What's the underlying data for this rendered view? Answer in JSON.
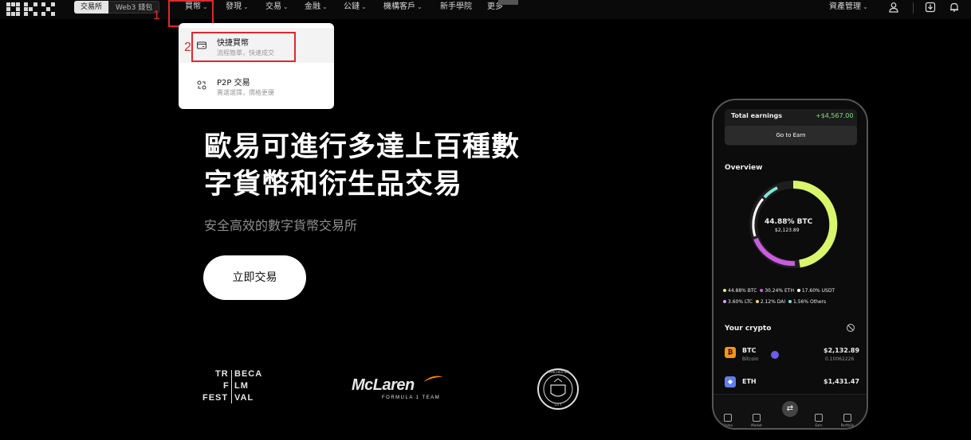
{
  "nav": {
    "segments": [
      "交易所",
      "Web3 錢包"
    ],
    "items": [
      {
        "label": "買幣",
        "chevron": true
      },
      {
        "label": "發現",
        "chevron": true
      },
      {
        "label": "交易",
        "chevron": true
      },
      {
        "label": "金融",
        "chevron": true
      },
      {
        "label": "公鏈",
        "chevron": true
      },
      {
        "label": "機構客戶",
        "chevron": true
      },
      {
        "label": "新手學院",
        "chevron": false
      },
      {
        "label": "更多",
        "chevron": false
      }
    ],
    "asset_management": "資產管理"
  },
  "annotations": {
    "step1": "1",
    "step2": "2"
  },
  "dropdown": {
    "items": [
      {
        "title": "快捷買幣",
        "subtitle": "流程簡單，快速成交",
        "icon": "card-icon"
      },
      {
        "title": "P2P 交易",
        "subtitle": "賣選選擇，價格更優",
        "icon": "p2p-users-icon"
      }
    ]
  },
  "hero": {
    "title_line1": "歐易可進行多達上百種數",
    "title_line2": "字貨幣和衍生品交易",
    "subtitle": "安全高效的數字貨幣交易所",
    "cta": "立即交易"
  },
  "partners": {
    "tribeca": [
      "TR",
      "BECA",
      "F",
      "LM",
      "FEST",
      "VAL"
    ],
    "mclaren_name": "McLaren",
    "mclaren_sub": "FORMULA 1 TEAM",
    "city_top": "MANCHESTER",
    "city_bottom": "CITY"
  },
  "phone": {
    "earnings_label": "Total earnings",
    "earnings_value": "+$4,567.00",
    "earn_button": "Go to Earn",
    "overview_label": "Overview",
    "donut_center_pct": "44.88% BTC",
    "donut_center_val": "$2,123.89",
    "legend": [
      {
        "label": "44.88% BTC",
        "color": "#d9f56b"
      },
      {
        "label": "30.24% ETH",
        "color": "#c95ce0"
      },
      {
        "label": "17.60% USDT",
        "color": "#ffffff"
      },
      {
        "label": "3.60% LTC",
        "color": "#e0a0ff"
      },
      {
        "label": "2.12% DAI",
        "color": "#f5d36b"
      },
      {
        "label": "1.56% Others",
        "color": "#7fe6d9"
      }
    ],
    "your_crypto_label": "Your crypto",
    "coins": [
      {
        "symbol": "BTC",
        "name": "Bitcoin",
        "price": "$2,132.89",
        "amount": "0.10062226",
        "color": "#f7931a"
      },
      {
        "symbol": "ETH",
        "name": "",
        "price": "$1,431.47",
        "amount": "",
        "color": "#627eea"
      }
    ],
    "tabs": [
      "Home",
      "Market",
      "",
      "Earn",
      "Portfolio"
    ]
  }
}
